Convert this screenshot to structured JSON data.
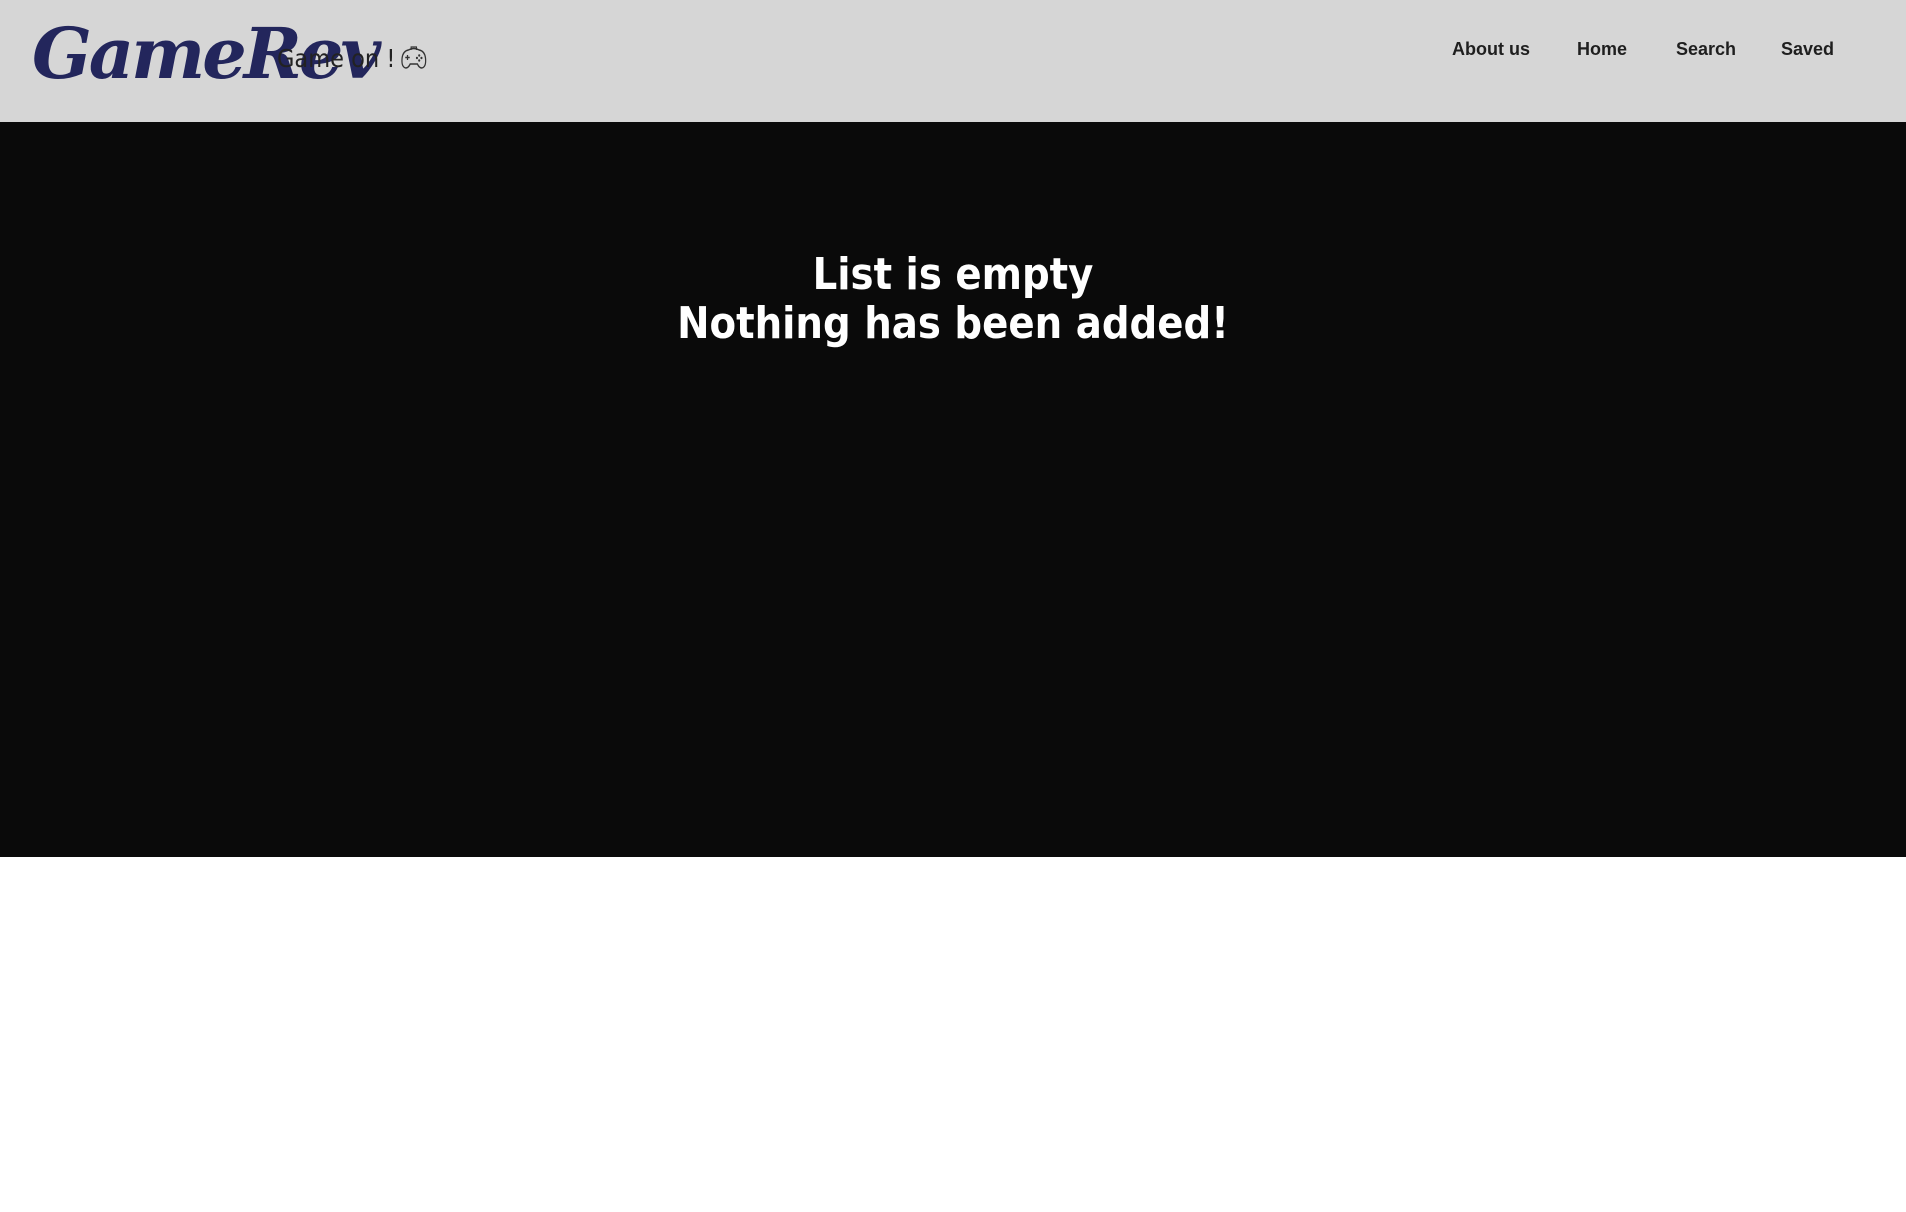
{
  "header": {
    "logo_text": "GameRev",
    "tagline": "Game on !",
    "tagline_icon": "gamepad-icon",
    "nav": [
      {
        "label": "About us"
      },
      {
        "label": "Home"
      },
      {
        "label": "Search"
      },
      {
        "label": "Saved"
      }
    ]
  },
  "main": {
    "empty_title": "List is empty",
    "empty_subtitle": "Nothing has been added!"
  },
  "colors": {
    "header_bg": "#d6d6d6",
    "logo": "#23265c",
    "main_bg": "#0a0a0a",
    "message_text": "#ffffff"
  }
}
